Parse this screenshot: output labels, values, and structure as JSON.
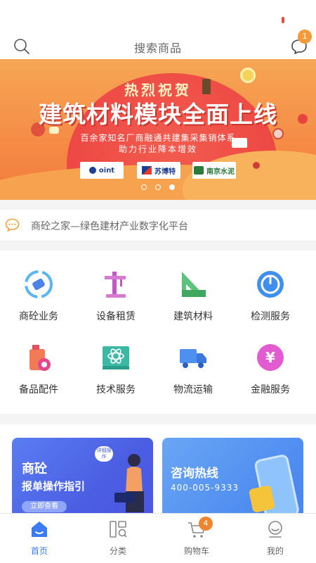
{
  "header": {
    "search_placeholder": "搜索商品",
    "message_badge": "1"
  },
  "banner": {
    "small_title": "热烈祝贺",
    "title": "建筑材料模块全面上线",
    "subtitle_line1": "百余家知名厂商融通共建集采集销体系",
    "subtitle_line2": "助力行业降本增效",
    "logos": [
      "oint",
      "苏博特",
      "南京水泥"
    ],
    "page_count": 3,
    "active_page": 3
  },
  "notice": {
    "text": "商砼之家—绿色建材产业数字化平台"
  },
  "services": [
    {
      "label": "商砼业务",
      "icon": "concrete-recycle-icon"
    },
    {
      "label": "设备租赁",
      "icon": "crane-icon"
    },
    {
      "label": "建筑材料",
      "icon": "ruler-triangle-icon"
    },
    {
      "label": "检测服务",
      "icon": "gauge-icon"
    },
    {
      "label": "备品配件",
      "icon": "oil-can-icon"
    },
    {
      "label": "技术服务",
      "icon": "atom-board-icon"
    },
    {
      "label": "物流运输",
      "icon": "truck-icon"
    },
    {
      "label": "金融服务",
      "icon": "yen-coin-icon"
    }
  ],
  "promos": {
    "left": {
      "title_line1": "商砼",
      "title_line2": "报单操作指引",
      "button": "立即查看",
      "bubble": "详细操作"
    },
    "right": {
      "title": "咨询热线",
      "phone": "400-005-9333"
    }
  },
  "tabs": [
    {
      "label": "首页",
      "icon": "home-icon",
      "active": true
    },
    {
      "label": "分类",
      "icon": "category-icon",
      "active": false
    },
    {
      "label": "购物车",
      "icon": "cart-icon",
      "active": false
    },
    {
      "label": "我的",
      "icon": "profile-icon",
      "active": false
    }
  ],
  "cart_badge": "4",
  "colors": {
    "accent": "#3b7cf5",
    "badge": "#f39a3a",
    "banner": "#f58b45"
  }
}
